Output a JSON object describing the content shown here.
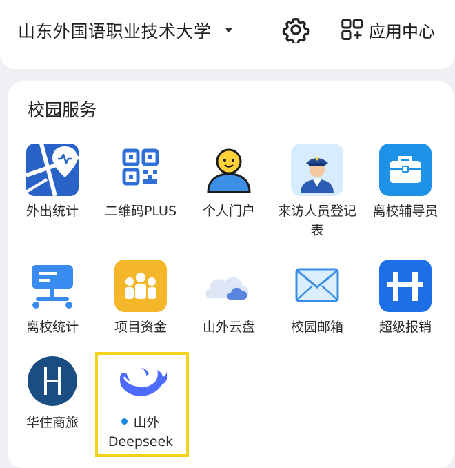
{
  "header": {
    "school_name": "山东外国语职业技术大学",
    "app_center_label": "应用中心"
  },
  "section": {
    "title": "校园服务"
  },
  "apps": [
    {
      "label": "外出统计"
    },
    {
      "label": "二维码PLUS"
    },
    {
      "label": "个人门户"
    },
    {
      "label": "来访人员登记表"
    },
    {
      "label": "离校辅导员"
    },
    {
      "label": "离校统计"
    },
    {
      "label": "项目资金"
    },
    {
      "label": "山外云盘"
    },
    {
      "label": "校园邮箱"
    },
    {
      "label": "超级报销"
    },
    {
      "label": "华住商旅"
    },
    {
      "label_line1": "山外",
      "label_line2": "Deepseek"
    }
  ],
  "colors": {
    "highlight": "#f2d21b",
    "new_dot": "#1e88e5",
    "brand_blue": "#1a73e8"
  }
}
